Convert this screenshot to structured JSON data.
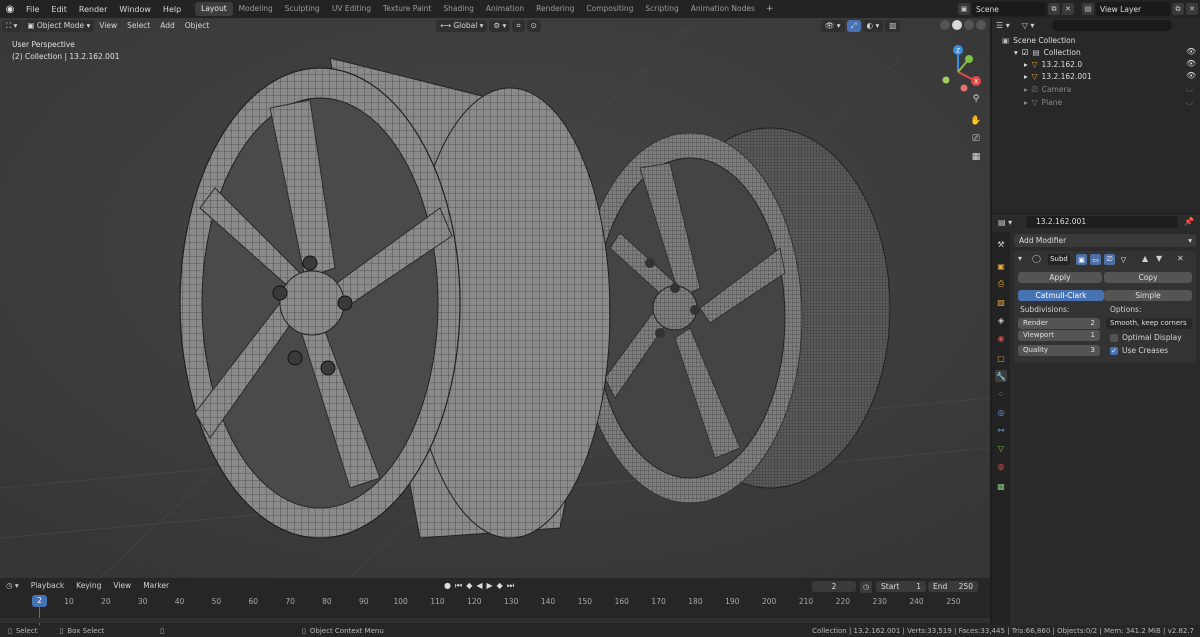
{
  "topbar": {
    "menus": [
      "File",
      "Edit",
      "Render",
      "Window",
      "Help"
    ],
    "workspaces": [
      "Layout",
      "Modeling",
      "Sculpting",
      "UV Editing",
      "Texture Paint",
      "Shading",
      "Animation",
      "Rendering",
      "Compositing",
      "Scripting",
      "Animation Nodes"
    ],
    "active_workspace": "Layout",
    "add_tab": "+",
    "scene": "Scene",
    "view_layer": "View Layer"
  },
  "viewport": {
    "mode": "Object Mode",
    "menus": [
      "View",
      "Select",
      "Add",
      "Object"
    ],
    "transform_orientation": "Global",
    "perspective_label": "User Perspective",
    "collection_label": "(2) Collection | 13.2.162.001",
    "gizmo_axes": {
      "x": "X",
      "y": "Y",
      "z": "Z"
    }
  },
  "outliner": {
    "root": "Scene Collection",
    "collection": "Collection",
    "items": [
      {
        "name": "13.2.162.0",
        "dim": false
      },
      {
        "name": "13.2.162.001",
        "dim": false
      },
      {
        "name": "Camera",
        "dim": true
      },
      {
        "name": "Plane",
        "dim": true
      }
    ]
  },
  "properties": {
    "object_name": "13.2.162.001",
    "add_modifier": "Add Modifier",
    "modifier_name": "Subd",
    "apply": "Apply",
    "copy": "Copy",
    "mode_catmull": "Catmull-Clark",
    "mode_simple": "Simple",
    "subdivisions_label": "Subdivisions:",
    "options_label": "Options:",
    "render_label": "Render",
    "render_value": "2",
    "viewport_label": "Viewport",
    "viewport_value": "1",
    "quality_label": "Quality",
    "quality_value": "3",
    "uv_option": "Smooth, keep corners",
    "optimal_display": "Optimal Display",
    "use_creases": "Use Creases"
  },
  "timeline": {
    "menus": [
      "Playback",
      "Keying",
      "View",
      "Marker"
    ],
    "current_frame": "2",
    "start_label": "Start",
    "start_value": "1",
    "end_label": "End",
    "end_value": "250",
    "ticks": [
      "10",
      "20",
      "30",
      "40",
      "50",
      "60",
      "70",
      "80",
      "90",
      "100",
      "110",
      "120",
      "130",
      "140",
      "150",
      "160",
      "170",
      "180",
      "190",
      "200",
      "210",
      "220",
      "230",
      "240",
      "250"
    ]
  },
  "statusbar": {
    "select": "Select",
    "box_select": "Box Select",
    "context_menu": "Object Context Menu",
    "stats": "Collection | 13.2.162.001 | Verts:33,519 | Faces:33,445 | Tris:66,860 | Objects:0/2 | Mem: 341.2 MiB | v2.82.7"
  },
  "colors": {
    "accent": "#4772b3",
    "viewport_bg": "#3e3e3e",
    "panel_bg": "#2b2b2b"
  }
}
